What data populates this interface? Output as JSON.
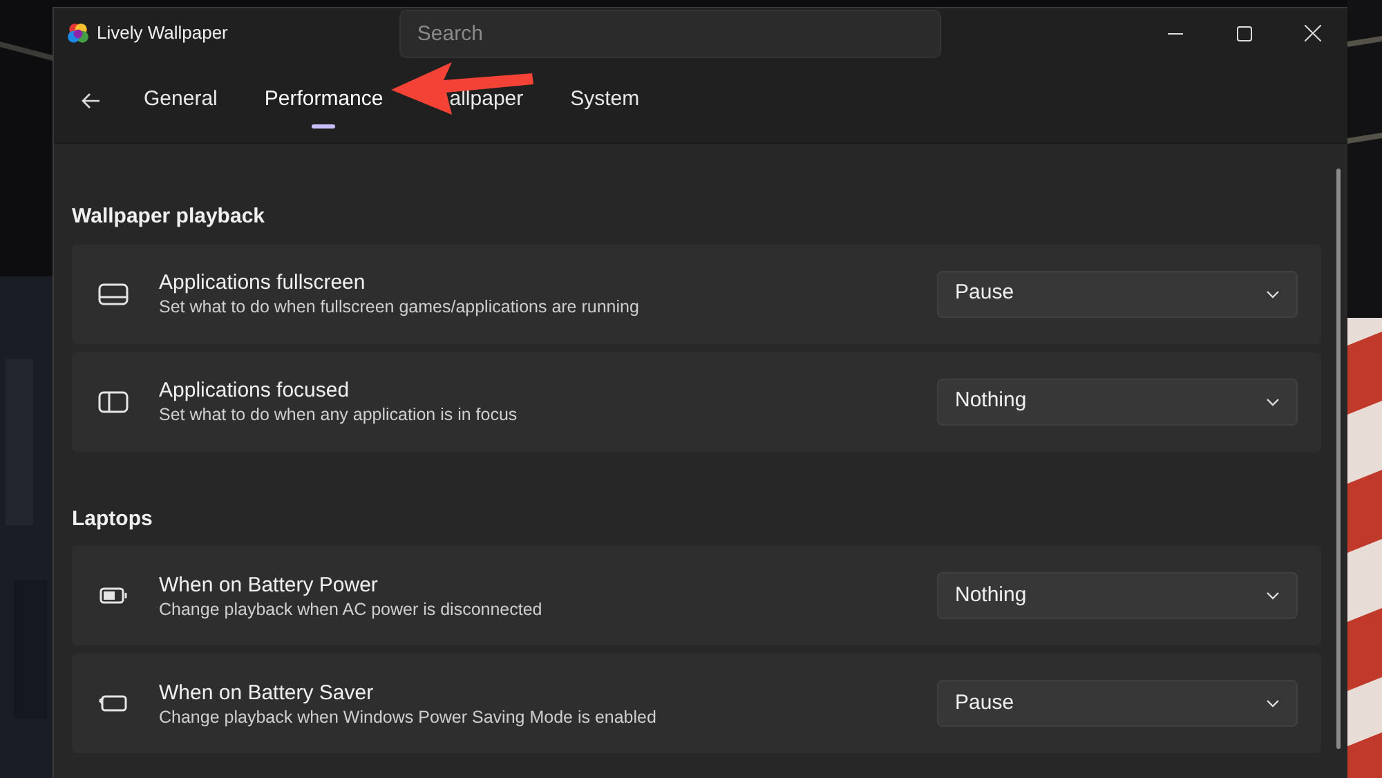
{
  "window": {
    "title": "Lively Wallpaper"
  },
  "search": {
    "placeholder": "Search"
  },
  "tabs": [
    {
      "label": "General",
      "selected": false
    },
    {
      "label": "Performance",
      "selected": true
    },
    {
      "label": "allpaper",
      "selected": false
    },
    {
      "label": "System",
      "selected": false
    }
  ],
  "sections": [
    {
      "title": "Wallpaper playback",
      "settings": [
        {
          "kind": "fullscreen",
          "title": "Applications fullscreen",
          "description": "Set what to do when fullscreen games/applications are running",
          "value": "Pause"
        },
        {
          "kind": "focused",
          "title": "Applications focused",
          "description": "Set what to do when any application is in focus",
          "value": "Nothing"
        }
      ]
    },
    {
      "title": "Laptops",
      "settings": [
        {
          "kind": "battery",
          "title": "When on Battery Power",
          "description": "Change playback when AC power is disconnected",
          "value": "Nothing"
        },
        {
          "kind": "battery-saver",
          "title": "When on Battery Saver",
          "description": "Change playback when Windows Power Saving Mode is enabled",
          "value": "Pause"
        }
      ]
    }
  ]
}
